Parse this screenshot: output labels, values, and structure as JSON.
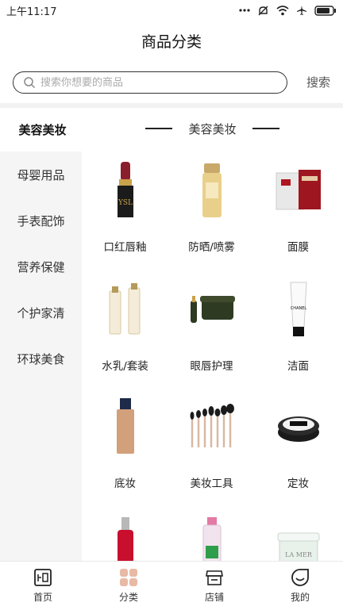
{
  "status": {
    "time": "上午11:17",
    "dots_icon": "more-dots-icon",
    "icons": [
      "mute-icon",
      "wifi-icon",
      "airplane-icon",
      "battery-icon"
    ]
  },
  "header": {
    "title": "商品分类"
  },
  "search": {
    "placeholder": "搜索你想要的商品",
    "button_label": "搜索",
    "icon": "search-icon"
  },
  "sidebar": {
    "items": [
      {
        "label": "美容美妆",
        "active": true
      },
      {
        "label": "母婴用品",
        "active": false
      },
      {
        "label": "手表配饰",
        "active": false
      },
      {
        "label": "营养保健",
        "active": false
      },
      {
        "label": "个护家清",
        "active": false
      },
      {
        "label": "环球美食",
        "active": false
      }
    ]
  },
  "section": {
    "title": "美容美妆"
  },
  "products": [
    {
      "name": "口红唇釉",
      "image": "lipstick"
    },
    {
      "name": "防晒/喷雾",
      "image": "sunscreen-bottle"
    },
    {
      "name": "面膜",
      "image": "face-mask-box"
    },
    {
      "name": "水乳/套装",
      "image": "lotion-set"
    },
    {
      "name": "眼唇护理",
      "image": "eye-cream-jar"
    },
    {
      "name": "洁面",
      "image": "cleanser-tube"
    },
    {
      "name": "底妆",
      "image": "foundation-bottle"
    },
    {
      "name": "美妆工具",
      "image": "makeup-brushes"
    },
    {
      "name": "定妆",
      "image": "loose-powder"
    },
    {
      "name": "",
      "image": "serum-bottle"
    },
    {
      "name": "",
      "image": "micellar-water"
    },
    {
      "name": "",
      "image": "cream-jar"
    }
  ],
  "tabbar": {
    "tabs": [
      {
        "label": "首页",
        "icon": "home-icon",
        "active": false
      },
      {
        "label": "分类",
        "icon": "category-icon",
        "active": true
      },
      {
        "label": "店铺",
        "icon": "store-icon",
        "active": false
      },
      {
        "label": "我的",
        "icon": "profile-icon",
        "active": false
      }
    ]
  },
  "colors": {
    "accent": "#e0a58c",
    "sidebar_bg": "#f5f5f5",
    "text": "#222222"
  }
}
